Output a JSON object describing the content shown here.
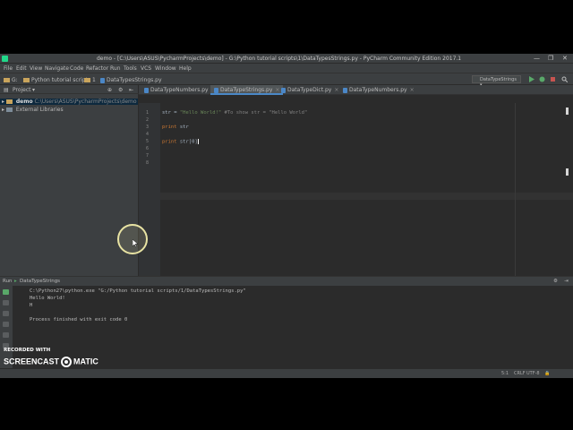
{
  "window": {
    "title": "demo - [C:\\Users\\ASUS\\PycharmProjects\\demo] - G:\\Python tutorial scripts\\1\\DataTypesStrings.py - PyCharm Community Edition 2017.1",
    "minimize": "—",
    "maximize": "❐",
    "close": "✕"
  },
  "menu": [
    "File",
    "Edit",
    "View",
    "Navigate",
    "Code",
    "Refactor",
    "Run",
    "Tools",
    "VCS",
    "Window",
    "Help"
  ],
  "navbar": {
    "crumbs": [
      "G:",
      "Python tutorial scripts",
      "1",
      "DataTypesStrings.py"
    ],
    "run_config": "DataTypeStrings"
  },
  "project_panel": {
    "title": "Project",
    "items": [
      {
        "label": "demo",
        "path": "C:\\Users\\ASUS\\PycharmProjects\\demo"
      },
      {
        "label": "External Libraries",
        "path": ""
      }
    ]
  },
  "tabs": [
    {
      "label": "DataTypeNumbers.py",
      "active": false
    },
    {
      "label": "DataTypeStrings.py",
      "active": true
    },
    {
      "label": "DataTypeDict.py",
      "active": false
    },
    {
      "label": "DataTypeNumbers.py",
      "active": false
    }
  ],
  "editor": {
    "line_numbers": [
      "1",
      "2",
      "3",
      "4",
      "5",
      "6",
      "7",
      "8"
    ],
    "lines": [
      {
        "kw": "",
        "text": "str = ",
        "str": "\"Hello World!\"",
        "comment": " #To show str = \"Hello World\""
      },
      {
        "kw": "",
        "text": "",
        "str": "",
        "comment": ""
      },
      {
        "kw": "print",
        "text": " str",
        "str": "",
        "comment": ""
      },
      {
        "kw": "",
        "text": "",
        "str": "",
        "comment": ""
      },
      {
        "kw": "print",
        "text": " str[0]",
        "str": "",
        "comment": ""
      },
      {
        "kw": "",
        "text": "",
        "str": "",
        "comment": ""
      },
      {
        "kw": "",
        "text": "",
        "str": "",
        "comment": ""
      },
      {
        "kw": "",
        "text": "",
        "str": "",
        "comment": ""
      }
    ]
  },
  "run_panel": {
    "title": "Run",
    "config": "DataTypeStrings",
    "output": [
      "C:\\Python27\\python.exe \"G:/Python tutorial scripts/1/DataTypesStrings.py\"",
      "Hello World!",
      "H",
      "",
      "Process finished with exit code 0"
    ]
  },
  "statusbar": {
    "position": "5:1",
    "line_sep": "CRLF",
    "encoding": "UTF-8"
  },
  "watermark": {
    "recorded": "RECORDED WITH",
    "brand_left": "SCREENCAST",
    "brand_right": "MATIC"
  },
  "colors": {
    "keyword": "#cc7832",
    "string": "#6a8759",
    "comment": "#808080",
    "accent": "#4a88c7"
  }
}
